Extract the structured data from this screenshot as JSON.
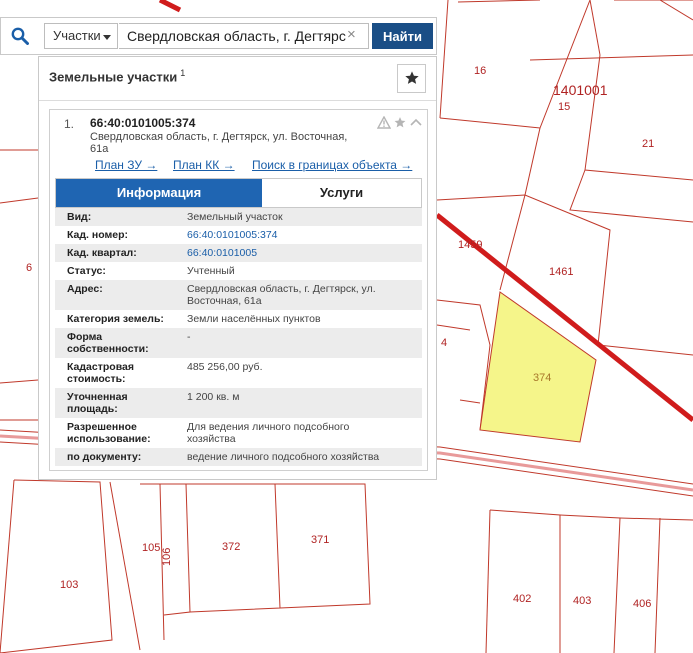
{
  "map": {
    "parcel_labels": [
      "16",
      "1401001",
      "15",
      "21",
      "1459",
      "1461",
      "6",
      "4",
      "374",
      "105",
      "106",
      "372",
      "371",
      "103",
      "402",
      "403",
      "406"
    ],
    "selected_fill": "#f5f58a",
    "border_color": "#c0392b",
    "road_color": "#d01c1c"
  },
  "search": {
    "category": "Участки",
    "query": "Свердловская область, г. Дегтярс",
    "clear_label": "×",
    "find_label": "Найти"
  },
  "panel": {
    "title": "Земельные участки",
    "count": "1",
    "item": {
      "index": "1.",
      "cadastral": "66:40:0101005:374",
      "address_line1": "Свердловская область, г. Дегтярск, ул. Восточная,",
      "address_line2": "61а",
      "links": [
        "План ЗУ →",
        "План КК →",
        "Поиск в границах объекта →"
      ],
      "tabs": [
        "Информация",
        "Услуги"
      ],
      "rows": [
        {
          "k1": "Вид:",
          "v1": "Земельный участок"
        },
        {
          "k1": "Кад. номер:",
          "v1": "66:40:0101005:374"
        },
        {
          "k1": "Кад. квартал:",
          "v1": "66:40:0101005"
        },
        {
          "k1": "Статус:",
          "v1": "Учтенный"
        },
        {
          "k1": "Адрес:",
          "v1": "Свердловская область, г. Дегтярск, ул.",
          "v2": "Восточная, 61а"
        },
        {
          "k1": "Категория земель:",
          "v1": "Земли населённых пунктов"
        },
        {
          "k1": "Форма",
          "k2": "собственности:",
          "v1": "-"
        },
        {
          "k1": "Кадастровая",
          "k2": "стоимость:",
          "v1": "485 256,00 руб."
        },
        {
          "k1": "Уточненная",
          "k2": "площадь:",
          "v1": "1 200 кв. м"
        },
        {
          "k1": "Разрешенное",
          "k2": "использование:",
          "v1": "Для ведения личного подсобного",
          "v2": "хозяйства"
        },
        {
          "k1": "по документу:",
          "v1": "ведение личного подсобного хозяйства"
        }
      ]
    }
  }
}
